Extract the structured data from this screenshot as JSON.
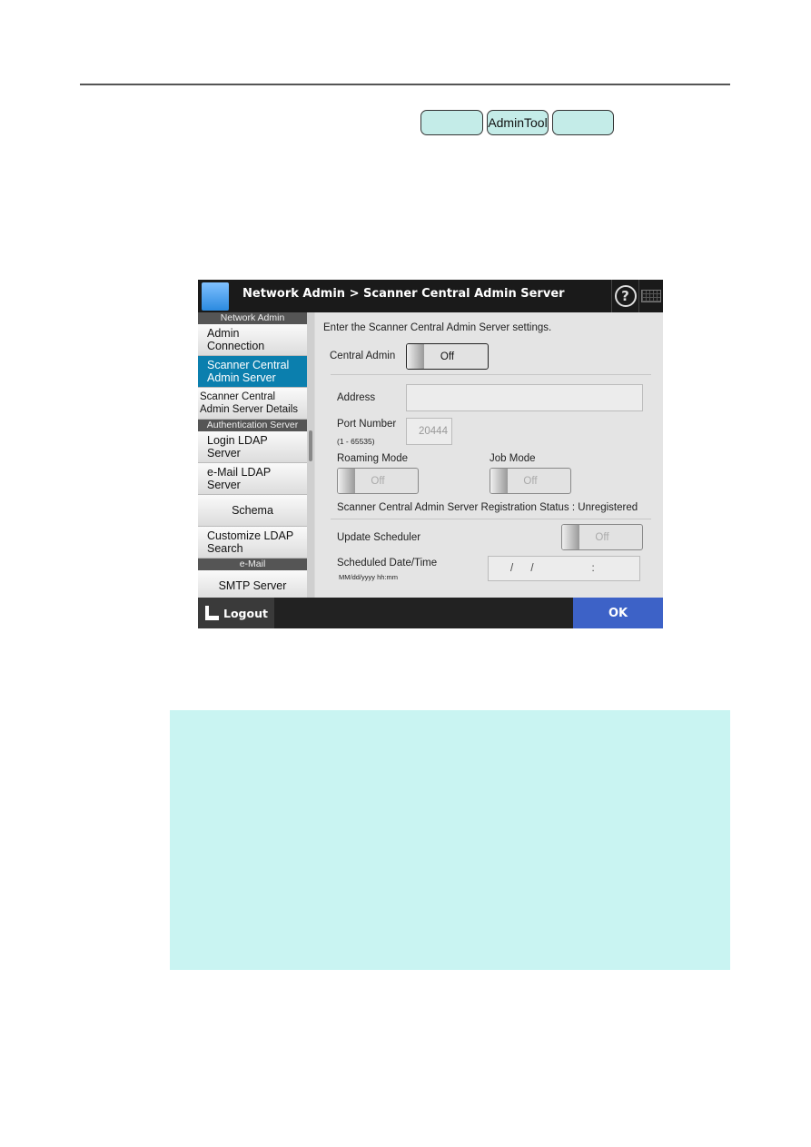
{
  "pills": [
    "",
    "AdminTool",
    ""
  ],
  "screen": {
    "title": "Network Admin > Scanner Central Admin Server",
    "sidebar": [
      {
        "type": "section",
        "label": "Network Admin"
      },
      {
        "type": "item",
        "label": "Admin Connection"
      },
      {
        "type": "item",
        "label": "Scanner Central Admin Server",
        "selected": true
      },
      {
        "type": "item",
        "label": "Scanner Central Admin Server Details"
      },
      {
        "type": "section",
        "label": "Authentication Server"
      },
      {
        "type": "item",
        "label": "Login LDAP Server"
      },
      {
        "type": "item",
        "label": "e-Mail LDAP Server"
      },
      {
        "type": "item",
        "label": "Schema"
      },
      {
        "type": "item",
        "label": "Customize LDAP Search"
      },
      {
        "type": "section",
        "label": "e-Mail"
      },
      {
        "type": "item",
        "label": "SMTP Server"
      }
    ],
    "main": {
      "intro": "Enter the Scanner Central Admin Server settings.",
      "central_admin_label": "Central Admin",
      "central_admin_value": "Off",
      "address_label": "Address",
      "address_value": "",
      "port_label": "Port Number",
      "port_range": "(1 - 65535)",
      "port_value": "20444",
      "roaming_label": "Roaming Mode",
      "roaming_value": "Off",
      "job_label": "Job Mode",
      "job_value": "Off",
      "status_label": "Scanner Central Admin Server Registration Status",
      "status_sep": ":",
      "status_value": "Unregistered",
      "scheduler_label": "Update Scheduler",
      "scheduler_value": "Off",
      "date_label": "Scheduled Date/Time",
      "date_format": "MM/dd/yyyy hh:mm",
      "date_placeholder": "/      /                    :"
    },
    "footer": {
      "logout": "Logout",
      "ok": "OK"
    }
  },
  "colors": {
    "selected": "#0b7fae",
    "ok": "#3d62c7",
    "note_bg": "#c9f4f2",
    "pill": "#c4ece8"
  }
}
